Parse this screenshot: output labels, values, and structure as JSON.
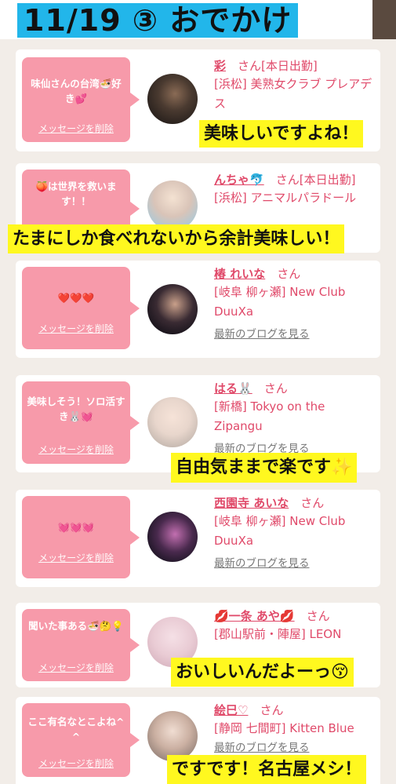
{
  "header": {
    "title": "11/19 ③ おでかけ"
  },
  "delete_label": "メッセージを削除",
  "blog_label": "最新のブログを見る",
  "cards": [
    {
      "message": "味仙さんの台湾🍜好き💕",
      "name": "彩",
      "san": "さん",
      "status": "[本日出勤]",
      "shop": "[浜松] 美熟女クラブ プレアデス"
    },
    {
      "message": "🍑は世界を救います！！",
      "name": "んちゃ🐬",
      "san": "さん",
      "status": "[本日出勤]",
      "shop": "[浜松] アニマルパラドール"
    },
    {
      "message": "❤️❤️❤️",
      "name": "椿 れいな",
      "san": "さん",
      "status": "",
      "shop": "[岐阜 柳ヶ瀬] New Club DuuXa"
    },
    {
      "message": "美味しそう！ソロ活すき🐰💓",
      "name": "はる🐰",
      "san": "さん",
      "status": "",
      "shop": "[新橋] Tokyo on the Zipangu"
    },
    {
      "message": "💓💓💓",
      "name": "西園寺 あいな",
      "san": "さん",
      "status": "",
      "shop": "[岐阜 柳ヶ瀬] New Club DuuXa"
    },
    {
      "message": "聞いた事ある🍜🤔💡",
      "name": "💋一条 あや💋",
      "san": "さん",
      "status": "",
      "shop": "[郡山駅前・陣屋] LEON"
    },
    {
      "message": "ここ有名なとこよね^ ^",
      "name": "絵巳♡",
      "san": "さん",
      "status": "",
      "shop": "[静岡 七間町] Kitten Blue"
    }
  ],
  "captions": [
    "美味しいですよね！",
    "たまにしか食べれないから余計美味しい！",
    "自由気ままで楽です✨",
    "おいしいんだよーっ😚",
    "ですです！名古屋メシ！"
  ],
  "colors": {
    "accent": "#e04a6a",
    "bubble": "#f79aaa",
    "title_bg": "#22b6ea",
    "caption_bg": "#fff81f"
  }
}
